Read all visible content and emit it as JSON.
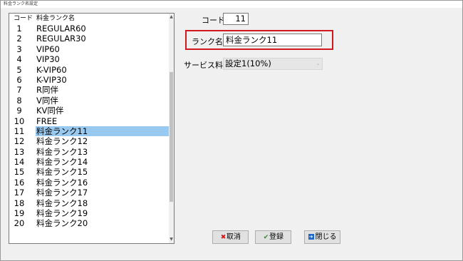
{
  "window": {
    "title": "料金ランク名設定"
  },
  "list": {
    "header_code": "コード",
    "header_name": "料金ランク名",
    "rows": [
      {
        "code": "1",
        "name": "REGULAR60"
      },
      {
        "code": "2",
        "name": "REGULAR30"
      },
      {
        "code": "3",
        "name": "VIP60"
      },
      {
        "code": "4",
        "name": "VIP30"
      },
      {
        "code": "5",
        "name": "K-VIP60"
      },
      {
        "code": "6",
        "name": "K-VIP30"
      },
      {
        "code": "7",
        "name": "R同伴"
      },
      {
        "code": "8",
        "name": "V同伴"
      },
      {
        "code": "9",
        "name": "KV同伴"
      },
      {
        "code": "10",
        "name": "FREE"
      },
      {
        "code": "11",
        "name": "料金ランク11"
      },
      {
        "code": "12",
        "name": "料金ランク12"
      },
      {
        "code": "13",
        "name": "料金ランク13"
      },
      {
        "code": "14",
        "name": "料金ランク14"
      },
      {
        "code": "15",
        "name": "料金ランク15"
      },
      {
        "code": "16",
        "name": "料金ランク16"
      },
      {
        "code": "17",
        "name": "料金ランク17"
      },
      {
        "code": "18",
        "name": "料金ランク18"
      },
      {
        "code": "19",
        "name": "料金ランク19"
      },
      {
        "code": "20",
        "name": "料金ランク20"
      }
    ],
    "selected_index": 10
  },
  "form": {
    "code_label": "コード",
    "code_value": "11",
    "name_label": "ランク名",
    "name_value": "料金ランク11",
    "service_label": "サービス料",
    "service_value": "設定1(10%)"
  },
  "buttons": {
    "cancel": "取消",
    "save": "登録",
    "close": "閉じる"
  },
  "colors": {
    "selection": "#99c9ef",
    "highlight_border": "#d0191c"
  }
}
